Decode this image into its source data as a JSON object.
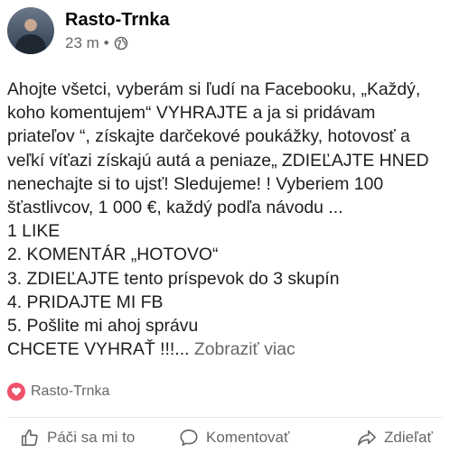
{
  "post": {
    "author": "Rasto-Trnka",
    "time": "23 m",
    "separator": "•",
    "visibility_icon": "globe-icon",
    "lines": [
      "Ahojte všetci, vyberám si ľudí na Facebooku, „Každý,",
      "koho komentujem“ VYHRAJTE a ja si pridávam",
      "priateľov “, získajte darčekové poukážky, hotovosť a",
      "veľkí víťazi získajú autá a peniaze„ ZDIEĽAJTE HNED",
      "nenechajte si to ujsť! Sledujeme! ! Vyberiem 100",
      "šťastlivcov, 1 000 €, každý podľa návodu ...",
      "1 LIKE",
      "2. KOMENTÁR „HOTOVO“",
      "3. ZDIEĽAJTE tento príspevok do 3 skupín",
      "4. PRIDAJTE MI FB",
      "5. Pošlite mi ahoj správu"
    ],
    "last_line_text": "CHCETE VYHRAŤ !!!...",
    "see_more": "Zobraziť viac"
  },
  "reactions": {
    "icon": "love-icon",
    "icon_color": "#f0516a",
    "name": "Rasto-Trnka"
  },
  "actions": {
    "like": "Páči sa mi to",
    "comment": "Komentovať",
    "share": "Zdieľať"
  },
  "colors": {
    "text": "#1c1e21",
    "secondary": "#65676b"
  }
}
